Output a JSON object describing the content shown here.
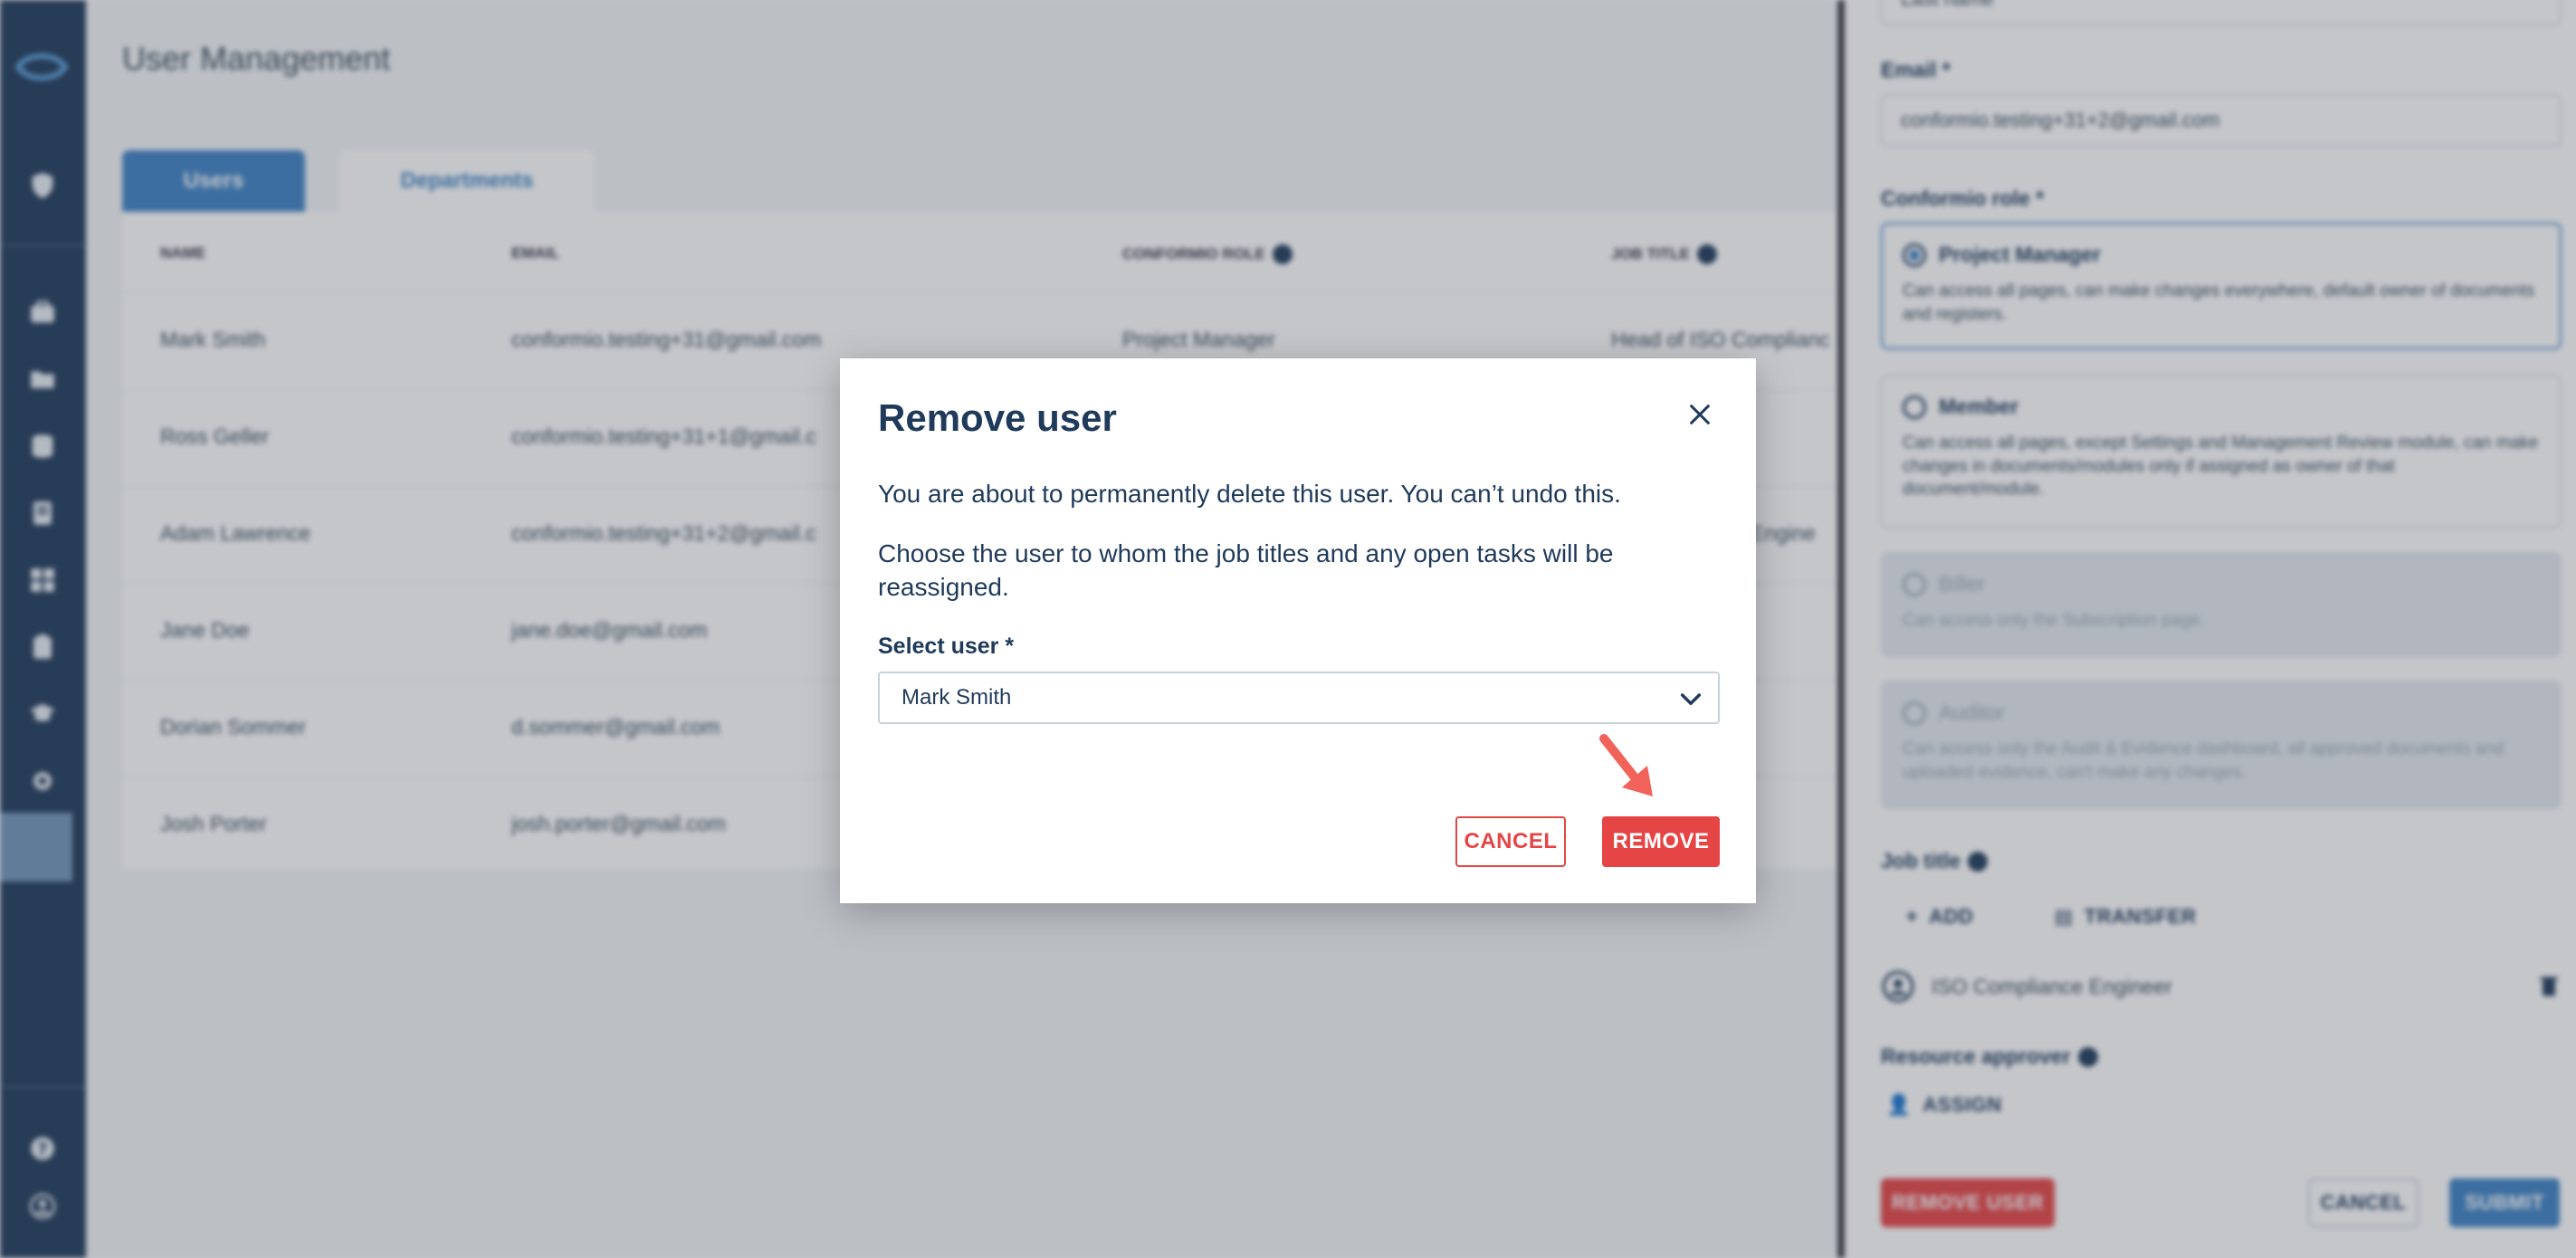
{
  "page": {
    "title": "User Management",
    "tabs": [
      {
        "label": "Users",
        "active": true
      },
      {
        "label": "Departments",
        "active": false
      }
    ]
  },
  "table": {
    "columns": [
      "NAME",
      "EMAIL",
      "CONFORMIO ROLE",
      "JOB TITLE"
    ],
    "rows": [
      {
        "name": "Mark Smith",
        "email": "conformio.testing+31@gmail.com",
        "role": "Project Manager",
        "job": "Head of ISO Complianc"
      },
      {
        "name": "Ross Geller",
        "email": "conformio.testing+31+1@gmail.c",
        "role": "",
        "job": ""
      },
      {
        "name": "Adam Lawrence",
        "email": "conformio.testing+31+2@gmail.c",
        "role": "",
        "job": "e Engine"
      },
      {
        "name": "Jane Doe",
        "email": "jane.doe@gmail.com",
        "role": "",
        "job": ""
      },
      {
        "name": "Dorian Sommer",
        "email": "d.sommer@gmail.com",
        "role": "",
        "job": ""
      },
      {
        "name": "Josh Porter",
        "email": "josh.porter@gmail.com",
        "role": "",
        "job": ""
      }
    ]
  },
  "drawer": {
    "top_value": "Last name",
    "email_label": "Email *",
    "email_value": "conformio.testing+31+2@gmail.com",
    "role_label": "Conformio role *",
    "roles": [
      {
        "title": "Project Manager",
        "desc": "Can access all pages, can make changes everywhere, default owner of documents and registers."
      },
      {
        "title": "Member",
        "desc": "Can access all pages, except Settings and Management Review module, can make changes in documents/modules only if assigned as owner of that document/module."
      },
      {
        "title": "Biller",
        "desc": "Can access only the Subscription page."
      },
      {
        "title": "Auditor",
        "desc": "Can access only the Audit & Evidence dashboard, all approved documents and uploaded evidence, can't make any changes."
      }
    ],
    "job_title_label": "Job title",
    "add_label": "ADD",
    "transfer_label": "TRANSFER",
    "job_item": "ISO Compliance Engineer",
    "resource_approver_label": "Resource approver",
    "assign_label": "ASSIGN",
    "remove_user_label": "REMOVE USER",
    "cancel_label": "CANCEL",
    "submit_label": "SUBMIT"
  },
  "modal": {
    "title": "Remove user",
    "text1": "You are about to permanently delete this user. You can’t undo this.",
    "text2": "Choose the user to whom the job titles and any open tasks will be reassigned.",
    "select_label": "Select user *",
    "select_value": "Mark Smith",
    "cancel_label": "CANCEL",
    "remove_label": "REMOVE"
  },
  "colors": {
    "sidebar": "#1f3a5a",
    "primary": "#3e82c4",
    "danger": "#e64545",
    "text": "#1f3a5a"
  },
  "icons": {
    "logo": "conformio-logo-icon",
    "sidebar": [
      "shield-icon",
      "briefcase-icon",
      "folder-icon",
      "database-icon",
      "report-icon",
      "dashboard-icon",
      "clipboard-icon",
      "graduation-cap-icon",
      "gear-icon",
      "help-icon",
      "account-icon"
    ]
  }
}
